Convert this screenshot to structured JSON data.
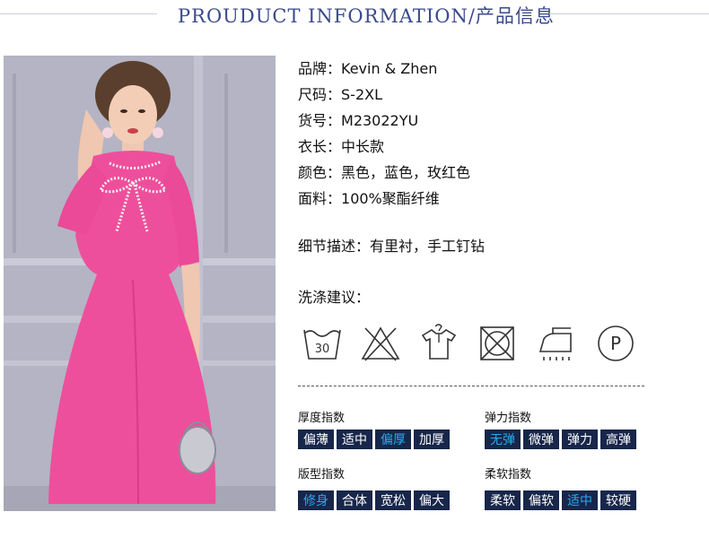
{
  "header": {
    "title": "PROUDUCT INFORMATION/产品信息"
  },
  "product_info": [
    {
      "key": "品牌：",
      "value": "Kevin & Zhen"
    },
    {
      "key": "尺码：",
      "value": "S-2XL"
    },
    {
      "key": "货号：",
      "value": "M23022YU"
    },
    {
      "key": "衣长：",
      "value": "中长款"
    },
    {
      "key": "颜色：",
      "value": "黑色，蓝色，玫红色"
    },
    {
      "key": "面料：",
      "value": "100%聚酯纤维"
    }
  ],
  "detail": "细节描述：有里衬，手工钉钻",
  "wash": {
    "title": "洗涤建议：",
    "icons": [
      "wash-30-icon",
      "no-bleach-icon",
      "hang-dry-icon",
      "no-tumble-dry-icon",
      "iron-steam-icon",
      "dry-clean-p-icon"
    ],
    "wash_temp": "30",
    "dry_clean_letter": "P"
  },
  "indices": [
    {
      "title": "厚度指数",
      "options": [
        "偏薄",
        "适中",
        "偏厚",
        "加厚"
      ],
      "selected": "偏厚"
    },
    {
      "title": "弹力指数",
      "options": [
        "无弹",
        "微弹",
        "弹力",
        "高弹"
      ],
      "selected": "无弹"
    },
    {
      "title": "版型指数",
      "options": [
        "修身",
        "合体",
        "宽松",
        "偏大"
      ],
      "selected": "修身"
    },
    {
      "title": "柔软指数",
      "options": [
        "柔软",
        "偏软",
        "适中",
        "较硬"
      ],
      "selected": "适中"
    }
  ],
  "colors": {
    "accent": "#3a4a8c",
    "cell_bg": "#17264a",
    "cell_text": "#ffffff",
    "cell_selected_text": "#2aa9f0",
    "dress": "#ee4f9c"
  }
}
